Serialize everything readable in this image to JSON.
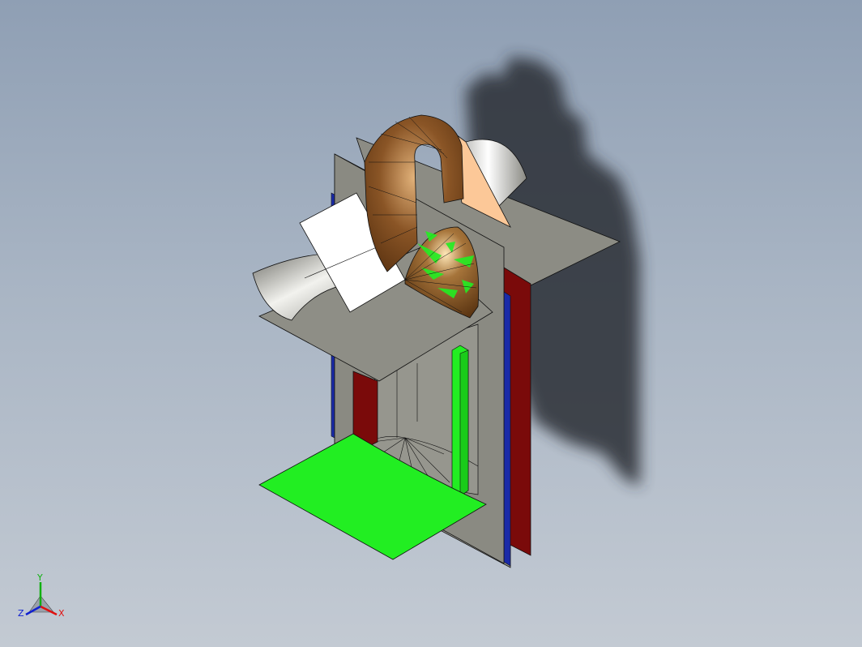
{
  "viewport": {
    "colors": {
      "background_top": "#8f9fb4",
      "background_bottom": "#c3cad3",
      "shadow": "#2b2f36",
      "sheet_metal": "#8e8e86",
      "sheet_metal_light": "#a7a79f",
      "duct_copper": "#7a4a1e",
      "highlight_green": "#22ee22",
      "blank_face": "#ffffff",
      "peach_face": "#fcc898",
      "red_rail": "#7a0a0a",
      "blue_rail": "#1a2aa8",
      "edge": "#111111"
    }
  },
  "triad": {
    "x_label": "X",
    "y_label": "Y",
    "z_label": "Z",
    "x_color": "#e01010",
    "y_color": "#10b010",
    "z_color": "#1020d0"
  }
}
